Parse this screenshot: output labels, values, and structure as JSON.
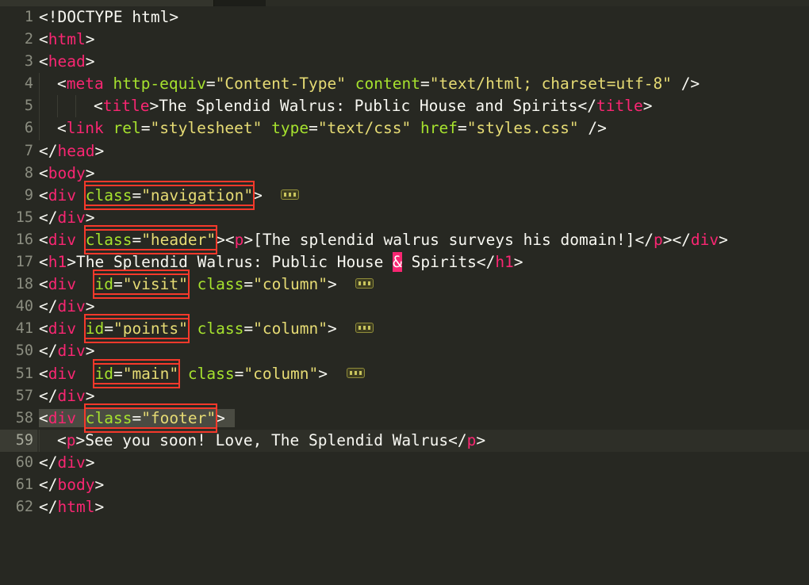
{
  "window": {
    "app": "code-editor",
    "theme_name": "monokai-dark",
    "language": "HTML"
  },
  "tabs": {
    "active_segment": "active-tab-edge",
    "inactive_segment": "inactive-tab-edge"
  },
  "theme_colors": {
    "background": "#272822",
    "gutter_text": "#8b8d80",
    "current_line_bg": "#2e2f28",
    "current_line_gutter_bg": "#3a3b33",
    "tag": "#f92672",
    "attribute_name": "#a6e22e",
    "attribute_value": "#e6db74",
    "plain_text": "#f8f8f2",
    "punctuation": "#f8f8f2",
    "error_highlight": "#f92672",
    "mark_outline": "#f5392b",
    "selection": "#4a4b42",
    "fold_marker_border": "#8f8c3a",
    "fold_marker_fill": "#3e3d20",
    "indent_guide": "#3b3c34"
  },
  "editor": {
    "current_line": 59,
    "folded_regions": [
      {
        "line": 9,
        "hidden_through": 14
      },
      {
        "line": 18,
        "hidden_through": 39
      },
      {
        "line": 41,
        "hidden_through": 49
      },
      {
        "line": 51,
        "hidden_through": 56
      }
    ],
    "marked_attributes": [
      "class=\"navigation\"",
      "class=\"header\"",
      "id=\"visit\"",
      "id=\"points\"",
      "id=\"main\"",
      "class=\"footer\""
    ],
    "error_tokens": [
      "&"
    ],
    "selected_line": 58
  },
  "lines": [
    {
      "n": "1",
      "text": "<!DOCTYPE html>"
    },
    {
      "n": "2",
      "text": "<html>"
    },
    {
      "n": "3",
      "text": "<head>"
    },
    {
      "n": "4",
      "text": "  <meta http-equiv=\"Content-Type\" content=\"text/html; charset=utf-8\" />"
    },
    {
      "n": "5",
      "text": "    <title>The Splendid Walrus: Public House and Spirits</title>"
    },
    {
      "n": "6",
      "text": "  <link rel=\"stylesheet\" type=\"text/css\" href=\"styles.css\" />"
    },
    {
      "n": "7",
      "text": "</head>"
    },
    {
      "n": "8",
      "text": "<body>"
    },
    {
      "n": "9",
      "text": "<div class=\"navigation\">"
    },
    {
      "n": "15",
      "text": "</div>"
    },
    {
      "n": "16",
      "text": "<div class=\"header\"><p>[The splendid walrus surveys his domain!]</p></div>"
    },
    {
      "n": "17",
      "text": "<h1>The Splendid Walrus: Public House & Spirits</h1>"
    },
    {
      "n": "18",
      "text": "<div id=\"visit\" class=\"column\">"
    },
    {
      "n": "40",
      "text": "</div>"
    },
    {
      "n": "41",
      "text": "<div id=\"points\" class=\"column\">"
    },
    {
      "n": "50",
      "text": "</div>"
    },
    {
      "n": "51",
      "text": "<div id=\"main\" class=\"column\">"
    },
    {
      "n": "57",
      "text": "</div>"
    },
    {
      "n": "58",
      "text": "<div class=\"footer\">"
    },
    {
      "n": "59",
      "text": "  <p>See you soon! Love, The Splendid Walrus</p>"
    },
    {
      "n": "60",
      "text": "</div>"
    },
    {
      "n": "61",
      "text": "</body>"
    },
    {
      "n": "62",
      "text": "</html>"
    }
  ],
  "line_numbers": {
    "l1": "1",
    "l2": "2",
    "l3": "3",
    "l4": "4",
    "l5": "5",
    "l6": "6",
    "l7": "7",
    "l8": "8",
    "l9": "9",
    "l15": "15",
    "l16": "16",
    "l17": "17",
    "l18": "18",
    "l40": "40",
    "l41": "41",
    "l50": "50",
    "l51": "51",
    "l57": "57",
    "l58": "58",
    "l59": "59",
    "l60": "60",
    "l61": "61",
    "l62": "62"
  },
  "tokens": {
    "doctype": "<!DOCTYPE html>",
    "t_html_open": "html",
    "t_html_close": "html",
    "t_head_open": "head",
    "t_head_close": "head",
    "t_body_open": "body",
    "t_body_close": "body",
    "t_meta": "meta",
    "t_title": "title",
    "t_link": "link",
    "t_div": "div",
    "t_p": "p",
    "t_h1": "h1",
    "a_http_equiv": "http-equiv",
    "v_content_type": "\"Content-Type\"",
    "a_content": "content",
    "v_text_html": "\"text/html; charset=utf-8\"",
    "a_rel": "rel",
    "v_stylesheet": "\"stylesheet\"",
    "a_type": "type",
    "v_text_css": "\"text/css\"",
    "a_href": "href",
    "v_styles_css": "\"styles.css\"",
    "a_class": "class",
    "v_navigation": "\"navigation\"",
    "v_header": "\"header\"",
    "v_column": "\"column\"",
    "v_footer": "\"footer\"",
    "a_id": "id",
    "v_visit": "\"visit\"",
    "v_points": "\"points\"",
    "v_main": "\"main\"",
    "title_text": "The Splendid Walrus: Public House and Spirits",
    "header_text": "[The splendid walrus surveys his domain!]",
    "h1_before": "The Splendid Walrus: Public House ",
    "h1_entity": "&",
    "h1_after": " Spirits",
    "footer_text": "See you soon! Love, The Splendid Walrus",
    "lt": "<",
    "gt": ">",
    "lt_slash": "</",
    "slash_gt": "/>",
    "eq": "="
  }
}
